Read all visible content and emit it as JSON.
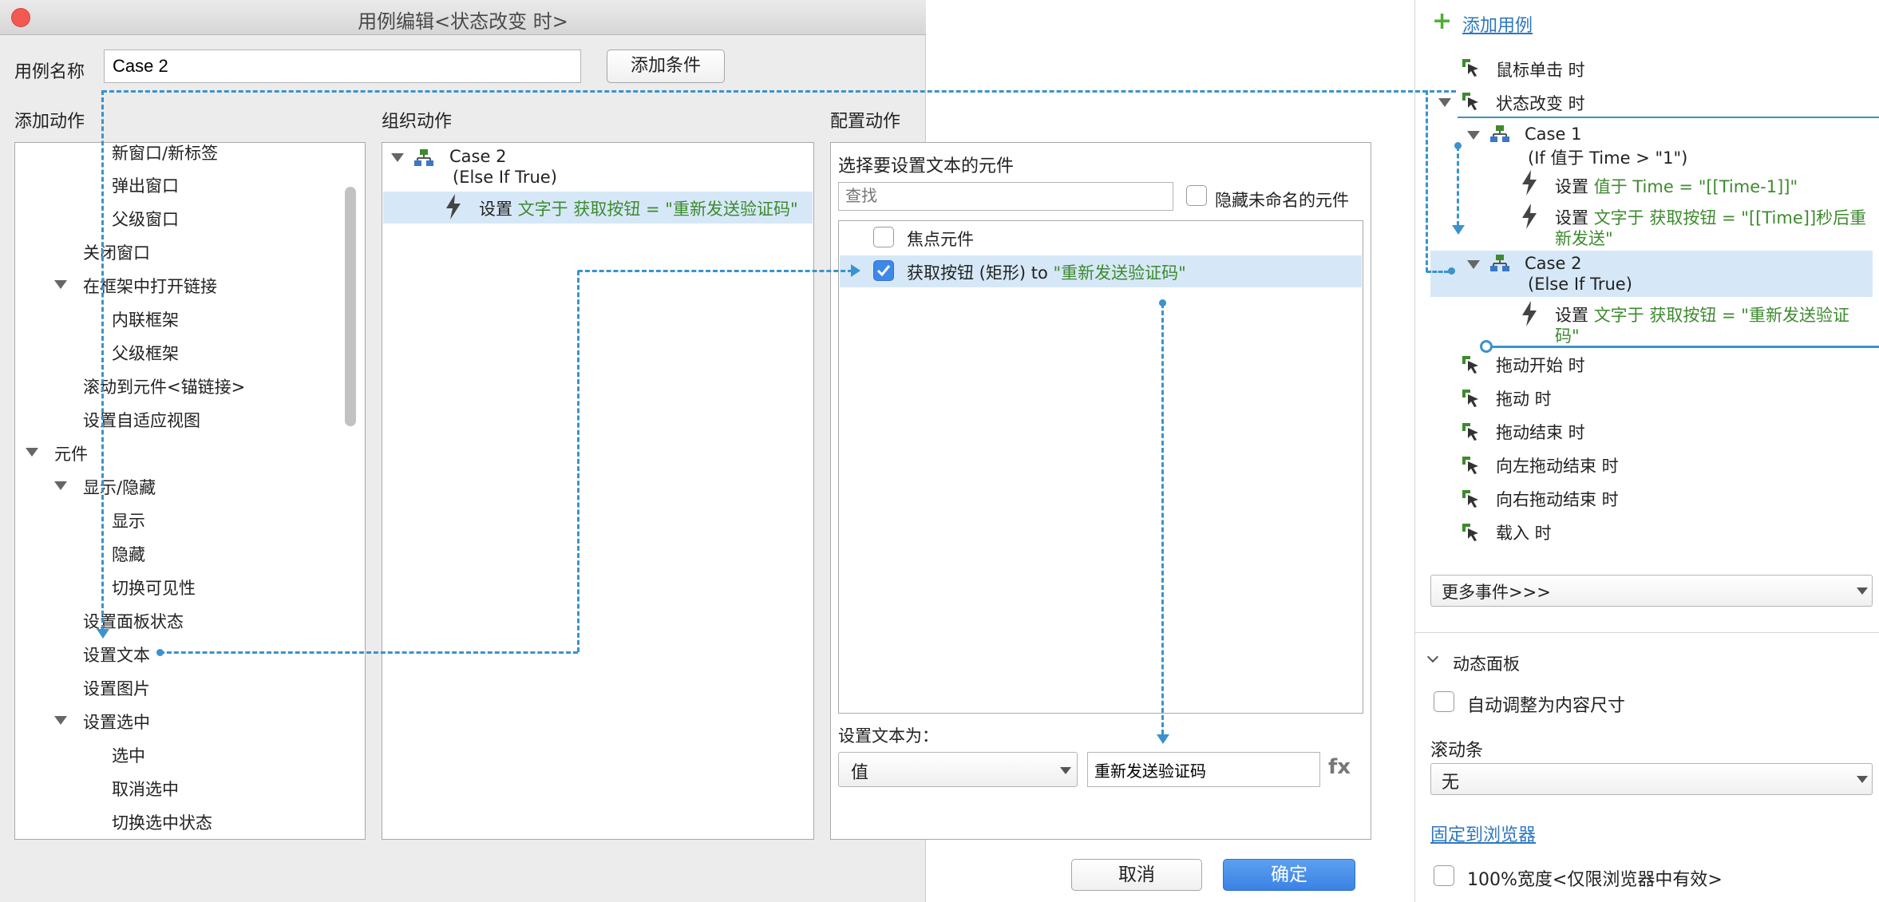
{
  "dialog": {
    "title": "用例编辑<状态改变 时>",
    "case_name_label": "用例名称",
    "case_name_value": "Case 2",
    "add_condition_button": "添加条件",
    "add_action_header": "添加动作",
    "organize_action_header": "组织动作",
    "config_action_header": "配置动作",
    "cancel_button": "取消",
    "ok_button": "确定"
  },
  "add_action_tree": {
    "items": [
      {
        "label": "新窗口/新标签"
      },
      {
        "label": "弹出窗口"
      },
      {
        "label": "父级窗口"
      },
      {
        "label": "关闭窗口"
      },
      {
        "label": "在框架中打开链接"
      },
      {
        "label": "内联框架"
      },
      {
        "label": "父级框架"
      },
      {
        "label": "滚动到元件<锚链接>"
      },
      {
        "label": "设置自适应视图"
      },
      {
        "label": "元件"
      },
      {
        "label": "显示/隐藏"
      },
      {
        "label": "显示"
      },
      {
        "label": "隐藏"
      },
      {
        "label": "切换可见性"
      },
      {
        "label": "设置面板状态"
      },
      {
        "label": "设置文本"
      },
      {
        "label": "设置图片"
      },
      {
        "label": "设置选中"
      },
      {
        "label": "选中"
      },
      {
        "label": "取消选中"
      },
      {
        "label": "切换选中状态"
      }
    ]
  },
  "organize": {
    "case_label": "Case 2",
    "case_condition": "(Else If True)",
    "action_prefix": "设置",
    "action_text": "文字于 获取按钮 = \"重新发送验证码\""
  },
  "config": {
    "select_widget_label": "选择要设置文本的元件",
    "search_placeholder": "查找",
    "hide_unnamed_label": "隐藏未命名的元件",
    "widgets": [
      {
        "label": "焦点元件",
        "value": "",
        "checked": false
      },
      {
        "label": "获取按钮 (矩形) to ",
        "value": "\"重新发送验证码\"",
        "checked": true
      }
    ],
    "set_text_label": "设置文本为：",
    "type_select_value": "值",
    "text_value": "重新发送验证码",
    "fx_label": "fx"
  },
  "right_panel": {
    "add_case_label": "添加用例",
    "events": [
      {
        "label": "鼠标单击 时"
      },
      {
        "label": "状态改变 时"
      },
      {
        "label": "拖动开始 时"
      },
      {
        "label": "拖动 时"
      },
      {
        "label": "拖动结束 时"
      },
      {
        "label": "向左拖动结束 时"
      },
      {
        "label": "向右拖动结束 时"
      },
      {
        "label": "载入 时"
      }
    ],
    "case1_label": "Case 1",
    "case1_condition": "(If 值于 Time > \"1\")",
    "case1_action1_prefix": "设置",
    "case1_action1_text": "值于 Time = \"[[Time-1]]\"",
    "case1_action2_prefix": "设置",
    "case1_action2_text_line1": "文字于 获取按钮 = \"[[Time]]秒后重",
    "case1_action2_text_line2": "新发送\"",
    "case2_label": "Case 2",
    "case2_condition": "(Else If True)",
    "case2_action_prefix": "设置",
    "case2_action_text_line1": "文字于 获取按钮 = \"重新发送验证",
    "case2_action_text_line2": "码\"",
    "more_events_value": "更多事件>>>",
    "dynamic_panel_label": "动态面板",
    "auto_fit_label": "自动调整为内容尺寸",
    "scrollbar_label": "滚动条",
    "scrollbar_value": "无",
    "pin_browser_label": "固定到浏览器",
    "full_width_label": "100%宽度<仅限浏览器中有效>"
  },
  "colors": {
    "accent_blue": "#3a93cc",
    "action_green": "#3d8a2f",
    "ok_button_blue": "#3d86e6",
    "selection_bg": "#d6e8f7"
  }
}
